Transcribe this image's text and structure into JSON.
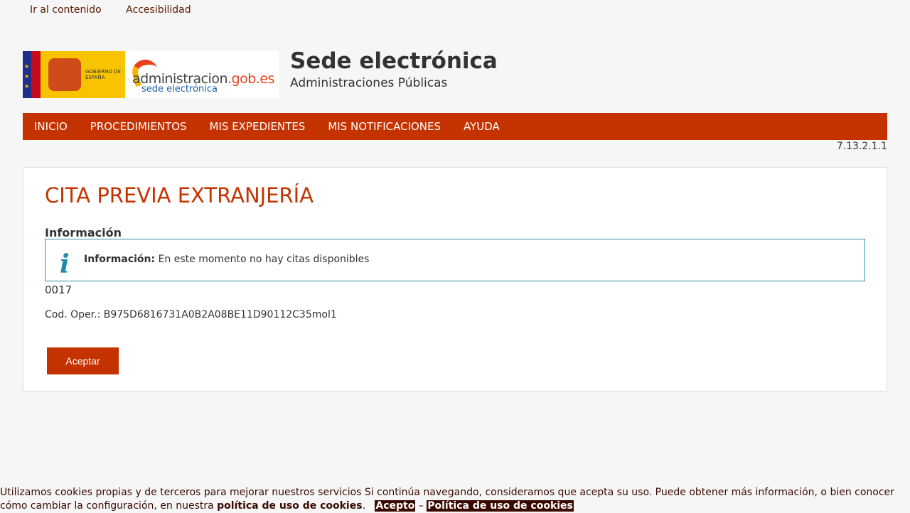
{
  "skip_links": {
    "content": "Ir al contenido",
    "accessibility": "Accesibilidad"
  },
  "header": {
    "title": "Sede electrónica",
    "subtitle": "Administraciones Públicas",
    "logo_gob": "GOBIERNO DE ESPAÑA",
    "logo_admin_main": "administracion",
    "logo_admin_domain": ".gob.es",
    "logo_admin_sub": "sede electrónica"
  },
  "nav": [
    "INICIO",
    "PROCEDIMIENTOS",
    "MIS EXPEDIENTES",
    "MIS NOTIFICACIONES",
    "AYUDA"
  ],
  "version": "7.13.2.1.1",
  "main": {
    "heading": "CITA PREVIA EXTRANJERÍA",
    "info_title": "Información",
    "info_label": "Información:",
    "info_message": "En este momento no hay citas disponibles",
    "code": "0017",
    "oper_code": "Cod. Oper.: B975D6816731A0B2A08BE11D90112C35mol1",
    "accept_button": "Aceptar"
  },
  "cookie": {
    "text1": "Utilizamos cookies propias y de terceros para mejorar nuestros servicios Si continúa navegando, consideramos que acepta su uso. Puede obtener más información, o bien conocer cómo cambiar la configuración, en nuestra ",
    "policy_link": "política de uso de cookies",
    "text2": ".",
    "accept": "Acepto",
    "separator": " – ",
    "policy_button": "Política de uso de cookies"
  },
  "colors": {
    "brand": "#c43200",
    "info_border": "#2f8ea0",
    "info_icon": "#1f8ca8"
  },
  "icons": {
    "info": "info-icon"
  }
}
